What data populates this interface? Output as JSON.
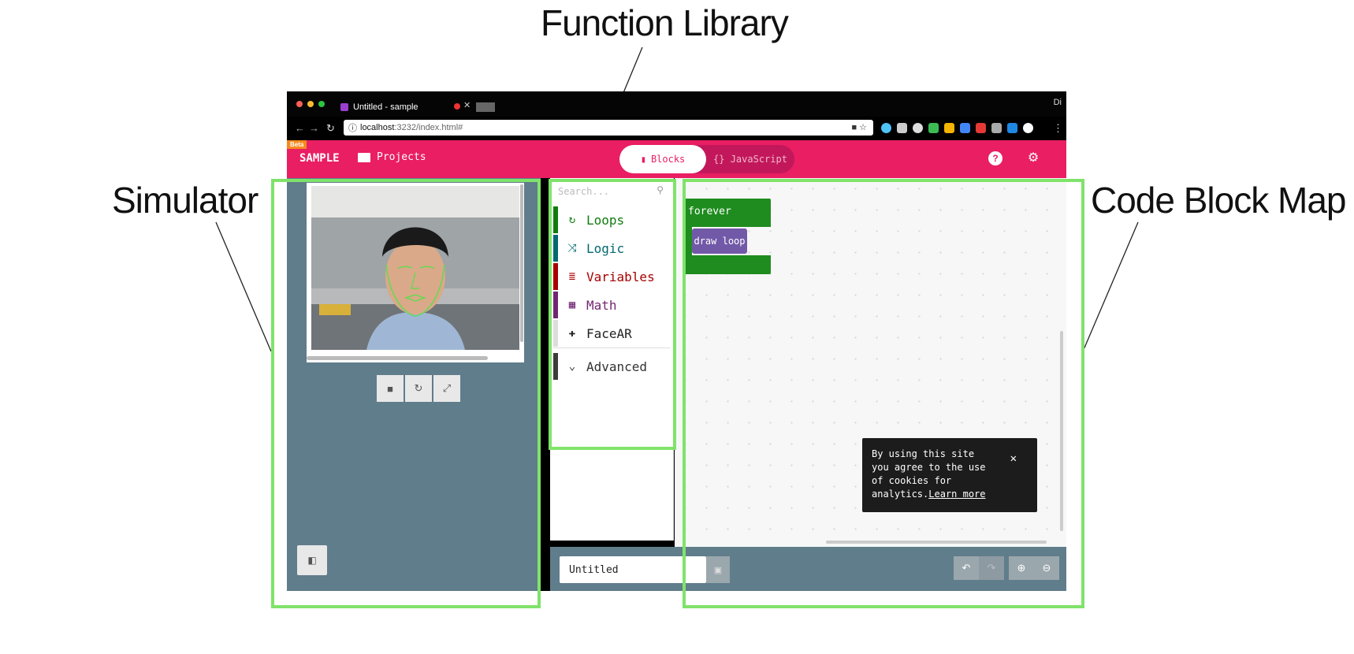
{
  "callouts": {
    "function_library": "Function Library",
    "simulator": "Simulator",
    "code_block_map": "Code Block Map"
  },
  "browser": {
    "tab_title": "Untitled - sample",
    "url_host": "localhost",
    "url_path": ":3232/index.html#",
    "corner_text": "Di"
  },
  "app": {
    "beta_badge": "Beta",
    "brand": "SAMPLE",
    "projects_label": "Projects",
    "mode_blocks": "Blocks",
    "mode_javascript": "{} JavaScript",
    "accent_color": "#e91e63"
  },
  "toolbox": {
    "search_placeholder": "Search...",
    "categories": [
      {
        "label": "Loops",
        "color": "#107c10",
        "icon": "refresh-icon"
      },
      {
        "label": "Logic",
        "color": "#006970",
        "icon": "shuffle-icon"
      },
      {
        "label": "Variables",
        "color": "#a80000",
        "icon": "list-icon"
      },
      {
        "label": "Math",
        "color": "#712672",
        "icon": "calculator-icon"
      },
      {
        "label": "FaceAR",
        "color": "#222222",
        "icon": "puzzle-icon"
      }
    ],
    "advanced": "Advanced"
  },
  "workspace": {
    "forever_label": "forever",
    "draw_loop_label": "draw loop",
    "cookie_text": "By using this site you agree to the use of cookies for analytics.",
    "cookie_link": "Learn more"
  },
  "footer": {
    "project_name": "Untitled"
  }
}
